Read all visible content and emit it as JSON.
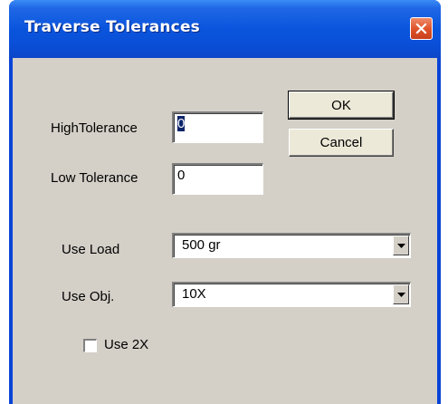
{
  "dialog": {
    "title": "Traverse Tolerances",
    "close_icon": "close-icon"
  },
  "buttons": {
    "ok_label": "OK",
    "cancel_label": "Cancel"
  },
  "fields": {
    "high_tolerance": {
      "label": "HighTolerance",
      "value": "0"
    },
    "low_tolerance": {
      "label": "Low Tolerance",
      "value": "0"
    }
  },
  "dropdowns": {
    "use_load": {
      "label": "Use Load",
      "selected": "500 gr"
    },
    "use_obj": {
      "label": "Use Obj.",
      "selected": "10X"
    }
  },
  "checkboxes": {
    "use_2x": {
      "label": "Use 2X",
      "checked": false
    }
  },
  "colors": {
    "title_bar": "#0a55dd",
    "close_button": "#de5128",
    "dialog_face": "#d4d0c8"
  }
}
